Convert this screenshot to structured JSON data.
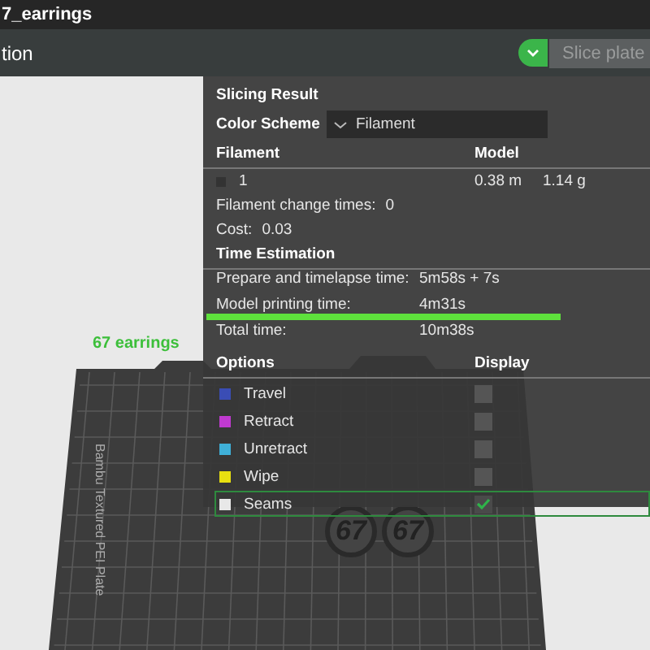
{
  "window": {
    "title": "7_earrings"
  },
  "toolbar": {
    "label": "tion",
    "slice_button": {
      "label": "Slice plate",
      "disabled": true
    }
  },
  "viewport": {
    "plate_label": "67 earrings",
    "plate_name": "Bambu Textured PEI Plate",
    "models": [
      {
        "text": "67"
      },
      {
        "text": "67"
      }
    ]
  },
  "slicing_result": {
    "title": "Slicing Result",
    "color_scheme": {
      "label": "Color Scheme",
      "value": "Filament"
    },
    "filament_table": {
      "columns": [
        "Filament",
        "Model"
      ],
      "rows": [
        {
          "name": "1",
          "color": "#333333",
          "length": "0.38 m",
          "weight": "1.14 g"
        }
      ]
    },
    "stats": [
      {
        "label": "Filament change times:",
        "value": "0"
      },
      {
        "label": "Cost:",
        "value": "0.03"
      }
    ],
    "time_estimation": {
      "title": "Time Estimation",
      "rows": [
        {
          "label": "Prepare and timelapse time:",
          "value": "5m58s + 7s",
          "highlighted": false
        },
        {
          "label": "Model printing time:",
          "value": "4m31s",
          "highlighted": true
        },
        {
          "label": "Total time:",
          "value": "10m38s",
          "highlighted": false
        }
      ]
    },
    "options": {
      "columns": [
        "Options",
        "Display"
      ],
      "items": [
        {
          "label": "Travel",
          "color": "#3a4db5",
          "checked": false,
          "selected": false
        },
        {
          "label": "Retract",
          "color": "#c03ad0",
          "checked": false,
          "selected": false
        },
        {
          "label": "Unretract",
          "color": "#3fb0d8",
          "checked": false,
          "selected": false
        },
        {
          "label": "Wipe",
          "color": "#e8e010",
          "checked": false,
          "selected": false
        },
        {
          "label": "Seams",
          "color": "#e8e8e8",
          "checked": true,
          "selected": true
        }
      ]
    }
  }
}
